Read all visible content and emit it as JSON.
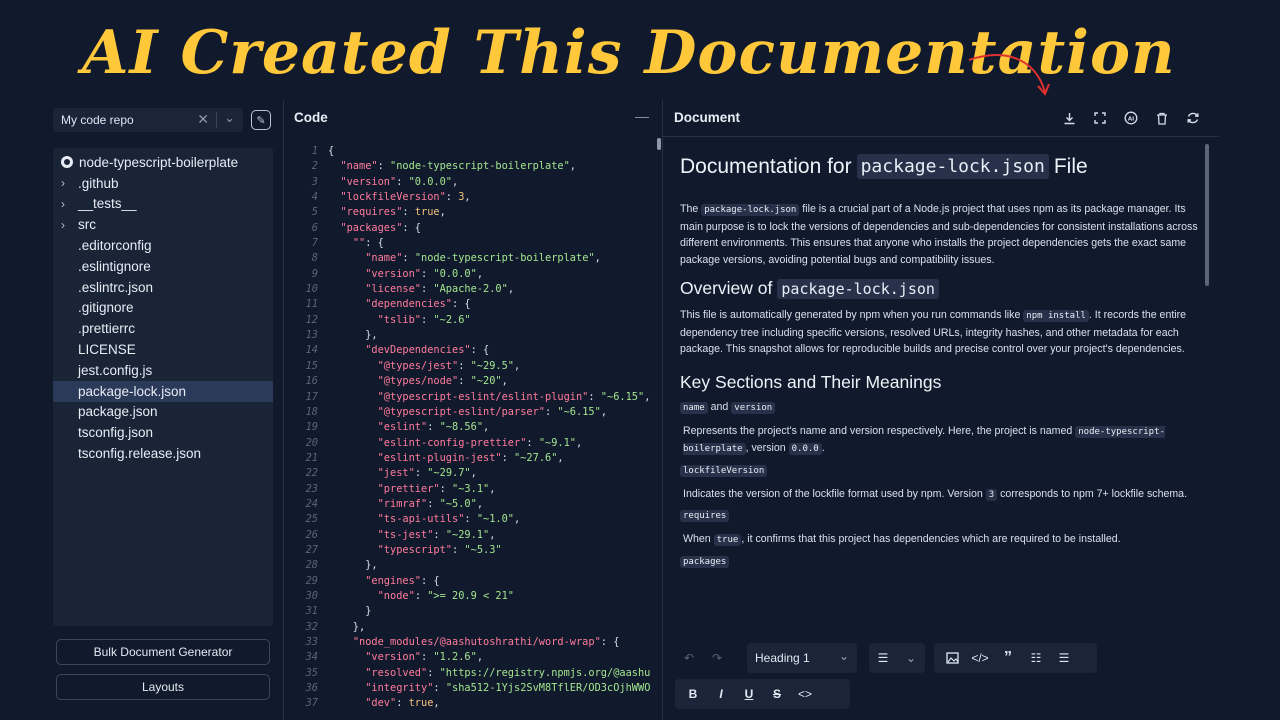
{
  "banner": {
    "text": "AI Created This Documentation"
  },
  "sidebar": {
    "repo_select_value": "My code repo",
    "tree": [
      {
        "label": "node-typescript-boilerplate",
        "kind": "root"
      },
      {
        "label": ".github",
        "kind": "folder"
      },
      {
        "label": "__tests__",
        "kind": "folder"
      },
      {
        "label": "src",
        "kind": "folder"
      },
      {
        "label": ".editorconfig",
        "kind": "file"
      },
      {
        "label": ".eslintignore",
        "kind": "file"
      },
      {
        "label": ".eslintrc.json",
        "kind": "file"
      },
      {
        "label": ".gitignore",
        "kind": "file"
      },
      {
        "label": ".prettierrc",
        "kind": "file"
      },
      {
        "label": "LICENSE",
        "kind": "file"
      },
      {
        "label": "jest.config.js",
        "kind": "file"
      },
      {
        "label": "package-lock.json",
        "kind": "file",
        "selected": true
      },
      {
        "label": "package.json",
        "kind": "file"
      },
      {
        "label": "tsconfig.json",
        "kind": "file"
      },
      {
        "label": "tsconfig.release.json",
        "kind": "file"
      }
    ],
    "bulk_button": "Bulk Document Generator",
    "layouts_button": "Layouts"
  },
  "code": {
    "title": "Code",
    "lines": [
      [
        [
          "p",
          "{"
        ]
      ],
      [
        [
          "p",
          "  "
        ],
        [
          "k",
          "\"name\""
        ],
        [
          "p",
          ": "
        ],
        [
          "s",
          "\"node-typescript-boilerplate\""
        ],
        [
          "p",
          ","
        ]
      ],
      [
        [
          "p",
          "  "
        ],
        [
          "k",
          "\"version\""
        ],
        [
          "p",
          ": "
        ],
        [
          "s",
          "\"0.0.0\""
        ],
        [
          "p",
          ","
        ]
      ],
      [
        [
          "p",
          "  "
        ],
        [
          "k",
          "\"lockfileVersion\""
        ],
        [
          "p",
          ": "
        ],
        [
          "n",
          "3"
        ],
        [
          "p",
          ","
        ]
      ],
      [
        [
          "p",
          "  "
        ],
        [
          "k",
          "\"requires\""
        ],
        [
          "p",
          ": "
        ],
        [
          "n",
          "true"
        ],
        [
          "p",
          ","
        ]
      ],
      [
        [
          "p",
          "  "
        ],
        [
          "k",
          "\"packages\""
        ],
        [
          "p",
          ": {"
        ]
      ],
      [
        [
          "p",
          "    "
        ],
        [
          "k",
          "\"\""
        ],
        [
          "p",
          ": {"
        ]
      ],
      [
        [
          "p",
          "      "
        ],
        [
          "k",
          "\"name\""
        ],
        [
          "p",
          ": "
        ],
        [
          "s",
          "\"node-typescript-boilerplate\""
        ],
        [
          "p",
          ","
        ]
      ],
      [
        [
          "p",
          "      "
        ],
        [
          "k",
          "\"version\""
        ],
        [
          "p",
          ": "
        ],
        [
          "s",
          "\"0.0.0\""
        ],
        [
          "p",
          ","
        ]
      ],
      [
        [
          "p",
          "      "
        ],
        [
          "k",
          "\"license\""
        ],
        [
          "p",
          ": "
        ],
        [
          "s",
          "\"Apache-2.0\""
        ],
        [
          "p",
          ","
        ]
      ],
      [
        [
          "p",
          "      "
        ],
        [
          "k",
          "\"dependencies\""
        ],
        [
          "p",
          ": {"
        ]
      ],
      [
        [
          "p",
          "        "
        ],
        [
          "k",
          "\"tslib\""
        ],
        [
          "p",
          ": "
        ],
        [
          "s",
          "\"~2.6\""
        ]
      ],
      [
        [
          "p",
          "      },"
        ]
      ],
      [
        [
          "p",
          "      "
        ],
        [
          "k",
          "\"devDependencies\""
        ],
        [
          "p",
          ": {"
        ]
      ],
      [
        [
          "p",
          "        "
        ],
        [
          "k",
          "\"@types/jest\""
        ],
        [
          "p",
          ": "
        ],
        [
          "s",
          "\"~29.5\""
        ],
        [
          "p",
          ","
        ]
      ],
      [
        [
          "p",
          "        "
        ],
        [
          "k",
          "\"@types/node\""
        ],
        [
          "p",
          ": "
        ],
        [
          "s",
          "\"~20\""
        ],
        [
          "p",
          ","
        ]
      ],
      [
        [
          "p",
          "        "
        ],
        [
          "k",
          "\"@typescript-eslint/eslint-plugin\""
        ],
        [
          "p",
          ": "
        ],
        [
          "s",
          "\"~6.15\""
        ],
        [
          "p",
          ","
        ]
      ],
      [
        [
          "p",
          "        "
        ],
        [
          "k",
          "\"@typescript-eslint/parser\""
        ],
        [
          "p",
          ": "
        ],
        [
          "s",
          "\"~6.15\""
        ],
        [
          "p",
          ","
        ]
      ],
      [
        [
          "p",
          "        "
        ],
        [
          "k",
          "\"eslint\""
        ],
        [
          "p",
          ": "
        ],
        [
          "s",
          "\"~8.56\""
        ],
        [
          "p",
          ","
        ]
      ],
      [
        [
          "p",
          "        "
        ],
        [
          "k",
          "\"eslint-config-prettier\""
        ],
        [
          "p",
          ": "
        ],
        [
          "s",
          "\"~9.1\""
        ],
        [
          "p",
          ","
        ]
      ],
      [
        [
          "p",
          "        "
        ],
        [
          "k",
          "\"eslint-plugin-jest\""
        ],
        [
          "p",
          ": "
        ],
        [
          "s",
          "\"~27.6\""
        ],
        [
          "p",
          ","
        ]
      ],
      [
        [
          "p",
          "        "
        ],
        [
          "k",
          "\"jest\""
        ],
        [
          "p",
          ": "
        ],
        [
          "s",
          "\"~29.7\""
        ],
        [
          "p",
          ","
        ]
      ],
      [
        [
          "p",
          "        "
        ],
        [
          "k",
          "\"prettier\""
        ],
        [
          "p",
          ": "
        ],
        [
          "s",
          "\"~3.1\""
        ],
        [
          "p",
          ","
        ]
      ],
      [
        [
          "p",
          "        "
        ],
        [
          "k",
          "\"rimraf\""
        ],
        [
          "p",
          ": "
        ],
        [
          "s",
          "\"~5.0\""
        ],
        [
          "p",
          ","
        ]
      ],
      [
        [
          "p",
          "        "
        ],
        [
          "k",
          "\"ts-api-utils\""
        ],
        [
          "p",
          ": "
        ],
        [
          "s",
          "\"~1.0\""
        ],
        [
          "p",
          ","
        ]
      ],
      [
        [
          "p",
          "        "
        ],
        [
          "k",
          "\"ts-jest\""
        ],
        [
          "p",
          ": "
        ],
        [
          "s",
          "\"~29.1\""
        ],
        [
          "p",
          ","
        ]
      ],
      [
        [
          "p",
          "        "
        ],
        [
          "k",
          "\"typescript\""
        ],
        [
          "p",
          ": "
        ],
        [
          "s",
          "\"~5.3\""
        ]
      ],
      [
        [
          "p",
          "      },"
        ]
      ],
      [
        [
          "p",
          "      "
        ],
        [
          "k",
          "\"engines\""
        ],
        [
          "p",
          ": {"
        ]
      ],
      [
        [
          "p",
          "        "
        ],
        [
          "k",
          "\"node\""
        ],
        [
          "p",
          ": "
        ],
        [
          "s",
          "\">= 20.9 < 21\""
        ]
      ],
      [
        [
          "p",
          "      }"
        ]
      ],
      [
        [
          "p",
          "    },"
        ]
      ],
      [
        [
          "p",
          "    "
        ],
        [
          "k",
          "\"node_modules/@aashutoshrathi/word-wrap\""
        ],
        [
          "p",
          ": {"
        ]
      ],
      [
        [
          "p",
          "      "
        ],
        [
          "k",
          "\"version\""
        ],
        [
          "p",
          ": "
        ],
        [
          "s",
          "\"1.2.6\""
        ],
        [
          "p",
          ","
        ]
      ],
      [
        [
          "p",
          "      "
        ],
        [
          "k",
          "\"resolved\""
        ],
        [
          "p",
          ": "
        ],
        [
          "s",
          "\"https://registry.npmjs.org/@aashu"
        ]
      ],
      [
        [
          "p",
          "      "
        ],
        [
          "k",
          "\"integrity\""
        ],
        [
          "p",
          ": "
        ],
        [
          "s",
          "\"sha512-1Yjs2SvM8TflER/OD3cOjhWWO"
        ]
      ],
      [
        [
          "p",
          "      "
        ],
        [
          "k",
          "\"dev\""
        ],
        [
          "p",
          ": "
        ],
        [
          "n",
          "true"
        ],
        [
          "p",
          ","
        ]
      ]
    ]
  },
  "document": {
    "title": "Document",
    "h1_prefix": "Documentation for",
    "h1_code": "package-lock.json",
    "h1_suffix": "File",
    "intro_pre": "The",
    "intro_code": "package-lock.json",
    "intro_post": "file is a crucial part of a Node.js project that uses npm as its package manager. Its main purpose is to lock the versions of dependencies and sub-dependencies for consistent installations across different environments. This ensures that anyone who installs the project dependencies gets the exact same package versions, avoiding potential bugs and compatibility issues.",
    "h2_overview_prefix": "Overview of",
    "h2_overview_code": "package-lock.json",
    "overview_pre": "This file is automatically generated by npm when you run commands like",
    "overview_code": "npm install",
    "overview_post": ". It records the entire dependency tree including specific versions, resolved URLs, integrity hashes, and other metadata for each package. This snapshot allows for reproducible builds and precise control over your project's dependencies.",
    "h2_key": "Key Sections and Their Meanings",
    "tag_name": "name",
    "tag_and": "and",
    "tag_version": "version",
    "name_desc_pre": "Represents the project's name and version respectively. Here, the project is named",
    "name_desc_code1": "node-typescript-boilerplate",
    "name_desc_mid": ", version",
    "name_desc_code2": "0.0.0",
    "name_desc_post": ".",
    "tag_lockfile": "lockfileVersion",
    "lockfile_pre": "Indicates the version of the lockfile format used by npm. Version",
    "lockfile_code": "3",
    "lockfile_post": "corresponds to npm 7+ lockfile schema.",
    "tag_requires": "requires",
    "requires_pre": "When",
    "requires_code": "true",
    "requires_post": ", it confirms that this project has dependencies which are required to be installed.",
    "tag_packages": "packages"
  },
  "editor_toolbar": {
    "heading_value": "Heading 1"
  },
  "colors": {
    "banner": "#ffc83a",
    "background": "#111a2c",
    "selected_row": "#2b3a58",
    "json_key": "#ff7b9c",
    "json_string": "#a3e48f",
    "json_number": "#f3c27d"
  }
}
